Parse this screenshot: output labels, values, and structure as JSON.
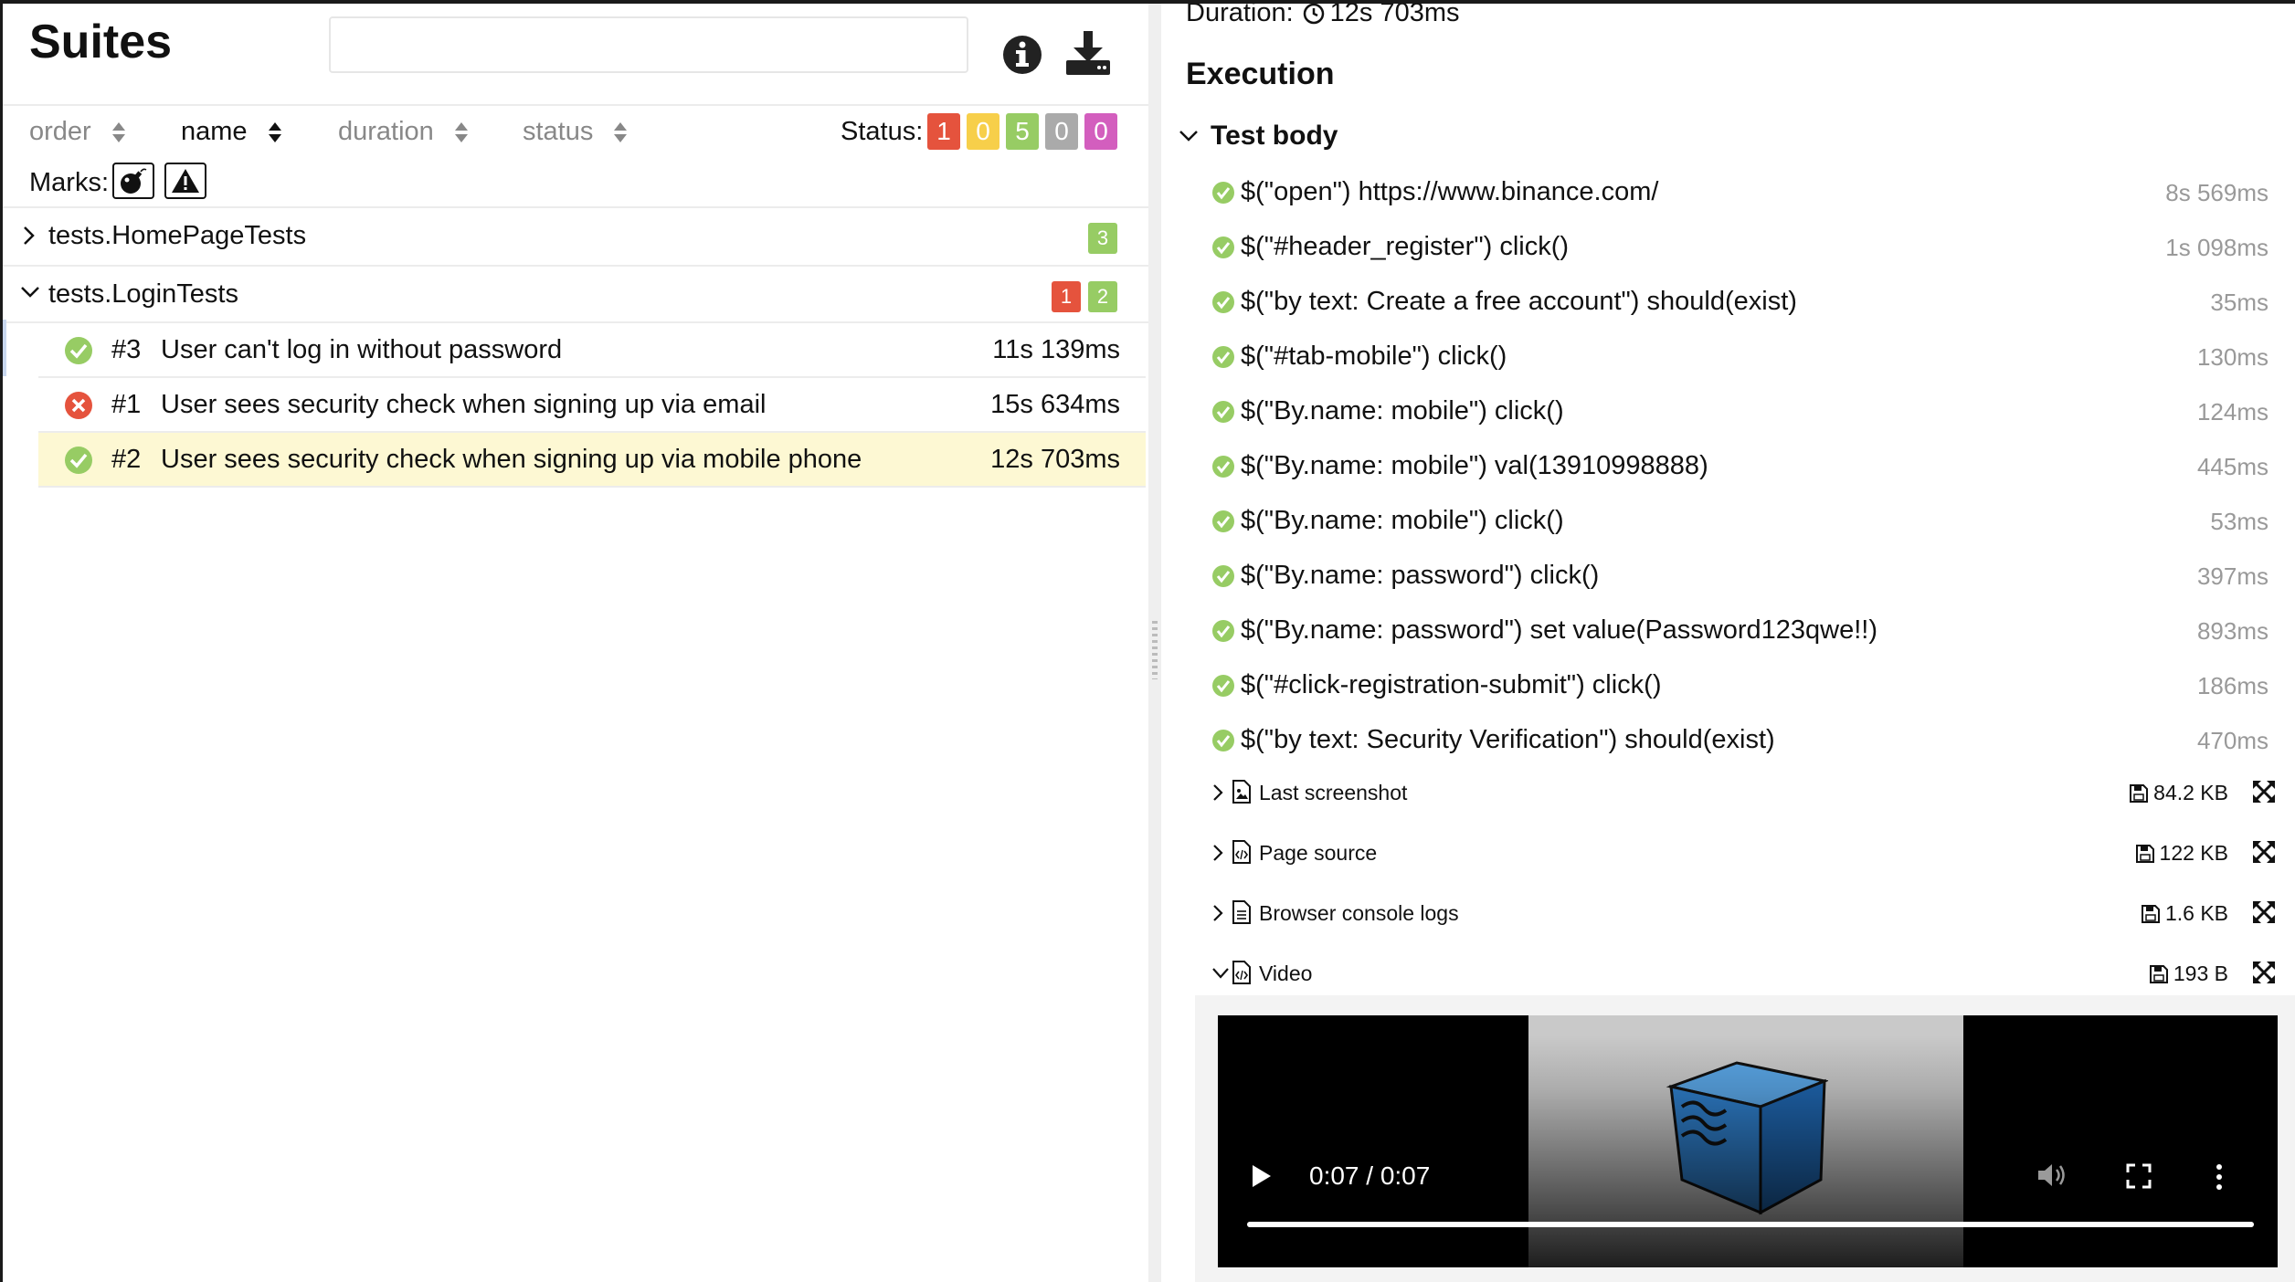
{
  "left": {
    "title": "Suites",
    "search_placeholder": "",
    "sort_columns": [
      {
        "label": "order",
        "active": false
      },
      {
        "label": "name",
        "active": true
      },
      {
        "label": "duration",
        "active": false
      },
      {
        "label": "status",
        "active": false
      }
    ],
    "status_label": "Status:",
    "status_counts": [
      {
        "value": "1",
        "color": "#e5533d"
      },
      {
        "value": "0",
        "color": "#f7cf4a"
      },
      {
        "value": "5",
        "color": "#97cc64"
      },
      {
        "value": "0",
        "color": "#aaaaaa"
      },
      {
        "value": "0",
        "color": "#d35ebe"
      }
    ],
    "marks_label": "Marks:",
    "suites": [
      {
        "name": "tests.HomePageTests",
        "expanded": false,
        "counts": [
          {
            "value": "3",
            "color": "#97cc64"
          }
        ]
      },
      {
        "name": "tests.LoginTests",
        "expanded": true,
        "counts": [
          {
            "value": "1",
            "color": "#e5533d"
          },
          {
            "value": "2",
            "color": "#97cc64"
          }
        ]
      }
    ],
    "tests": [
      {
        "num": "#3",
        "name": "User can't log in without password",
        "duration": "11s 139ms",
        "status": "passed"
      },
      {
        "num": "#1",
        "name": "User sees security check when signing up via email",
        "duration": "15s 634ms",
        "status": "failed"
      },
      {
        "num": "#2",
        "name": "User sees security check when signing up via mobile phone",
        "duration": "12s 703ms",
        "status": "passed"
      }
    ]
  },
  "right": {
    "duration_label": "Duration:",
    "duration_value": "12s 703ms",
    "execution_title": "Execution",
    "test_body_label": "Test body",
    "steps": [
      {
        "text": "$(\"open\") https://www.binance.com/",
        "ms": "8s 569ms"
      },
      {
        "text": "$(\"#header_register\") click()",
        "ms": "1s 098ms"
      },
      {
        "text": "$(\"by text: Create a free account\") should(exist)",
        "ms": "35ms"
      },
      {
        "text": "$(\"#tab-mobile\") click()",
        "ms": "130ms"
      },
      {
        "text": "$(\"By.name: mobile\") click()",
        "ms": "124ms"
      },
      {
        "text": "$(\"By.name: mobile\") val(13910998888)",
        "ms": "445ms"
      },
      {
        "text": "$(\"By.name: mobile\") click()",
        "ms": "53ms"
      },
      {
        "text": "$(\"By.name: password\") click()",
        "ms": "397ms"
      },
      {
        "text": "$(\"By.name: password\") set value(Password123qwe!!)",
        "ms": "893ms"
      },
      {
        "text": "$(\"#click-registration-submit\") click()",
        "ms": "186ms"
      },
      {
        "text": "$(\"by text: Security Verification\") should(exist)",
        "ms": "470ms"
      }
    ],
    "attachments": [
      {
        "label": "Last screenshot",
        "size": "84.2 KB",
        "icon": "image-file-icon",
        "expanded": false
      },
      {
        "label": "Page source",
        "size": "122 KB",
        "icon": "code-file-icon",
        "expanded": false
      },
      {
        "label": "Browser console logs",
        "size": "1.6 KB",
        "icon": "text-file-icon",
        "expanded": false
      },
      {
        "label": "Video",
        "size": "193 B",
        "icon": "code-file-icon",
        "expanded": true
      }
    ],
    "video": {
      "time": "0:07 / 0:07",
      "progress": 1.0
    }
  }
}
